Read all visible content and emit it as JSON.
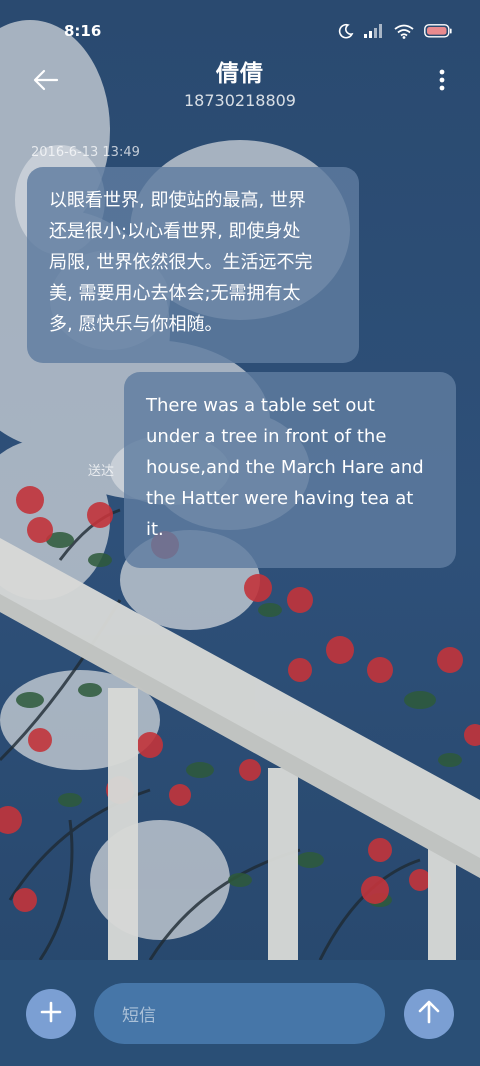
{
  "status_bar": {
    "time": "8:16",
    "icons": [
      "moon-icon",
      "signal-icon",
      "wifi-icon",
      "battery-icon"
    ]
  },
  "header": {
    "contact_name": "倩倩",
    "phone_number": "18730218809",
    "back_icon": "back-arrow-icon",
    "menu_icon": "more-vertical-icon"
  },
  "conversation": {
    "timestamp": "2016-6-13 13:49",
    "messages": [
      {
        "direction": "incoming",
        "lines": [
          "以眼看世界, 即使站的最高, 世界",
          "还是很小;以心看世界, 即使身处",
          "局限, 世界依然很大。生活远不完",
          "美, 需要用心去体会;无需拥有太",
          "多, 愿快乐与你相随。"
        ]
      },
      {
        "direction": "outgoing",
        "status": "送达",
        "lines": [
          "There was a table set out",
          "under a tree in front of the",
          "house,and the March Hare and",
          "the Hatter were having tea at",
          "it."
        ]
      }
    ]
  },
  "input_bar": {
    "placeholder": "短信",
    "add_icon": "plus-icon",
    "send_icon": "send-arrow-icon"
  },
  "colors": {
    "bubble": "#5f7da0",
    "input_bar": "#2a4f76",
    "input_field": "#4676a8",
    "button": "#7b9fd3"
  }
}
